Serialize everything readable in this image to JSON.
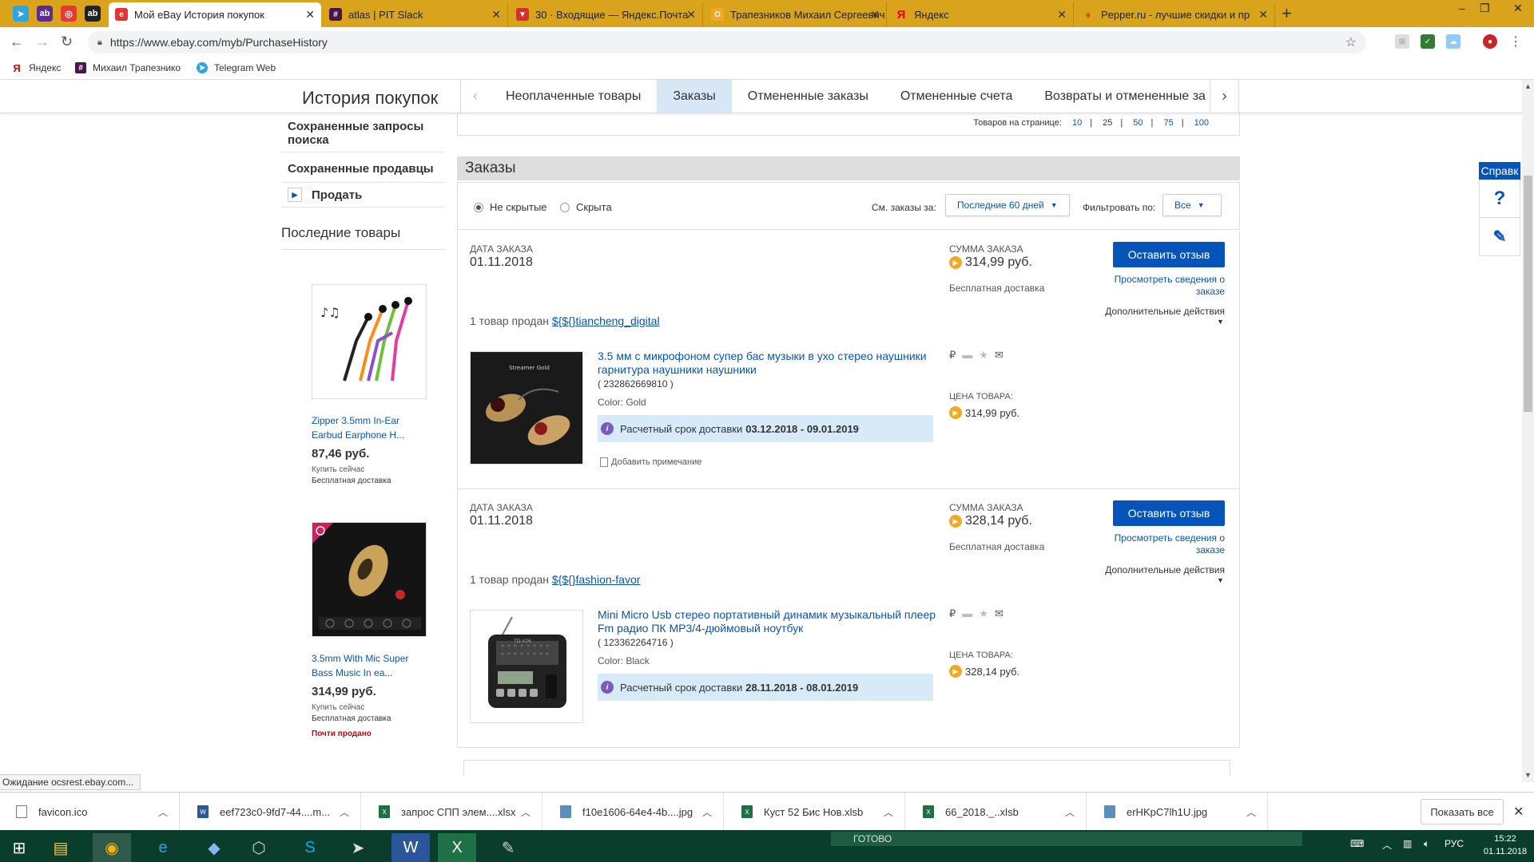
{
  "browser": {
    "tabs": [
      {
        "label": "Мой eBay История покупок",
        "active": true
      },
      {
        "label": "atlas | PIT Slack",
        "active": false
      },
      {
        "label": "30 · Входящие — Яндекс.Почта",
        "active": false
      },
      {
        "label": "Трапезников Михаил Сергеевич",
        "active": false
      },
      {
        "label": "Яндекс",
        "active": false
      },
      {
        "label": "Pepper.ru - лучшие скидки и пр",
        "active": false
      }
    ],
    "new_tab": "+",
    "url": "https://www.ebay.com/myb/PurchaseHistory",
    "bookmarks": [
      "Яндекс",
      "Михаил Трапезнико",
      "Telegram Web"
    ],
    "status_text": "Ожидание ocsrest.ebay.com..."
  },
  "header": {
    "title": "История покупок",
    "tabs": [
      "Неоплаченные товары",
      "Заказы",
      "Отмененные заказы",
      "Отмененные счета",
      "Возвраты и отмененные за"
    ],
    "selected_tab": "Заказы"
  },
  "leftnav": {
    "items": [
      "Сохраненные запросы поиска",
      "Сохраненные продавцы",
      "Продать"
    ],
    "recent_title": "Последние товары",
    "recent": [
      {
        "name": "Zipper 3.5mm In-Ear Earbud Earphone H...",
        "price": "87,46 руб.",
        "buy": "Купить сейчас",
        "shipping": "Бесплатная доставка",
        "badge": ""
      },
      {
        "name": "3.5mm With Mic Super Bass Music In ea...",
        "price": "314,99 руб.",
        "buy": "Купить сейчас",
        "shipping": "Бесплатная доставка",
        "badge": "Почти продано"
      }
    ]
  },
  "main": {
    "per_page_label": "Товаров на странице:",
    "per_page_options": [
      "10",
      "25",
      "50",
      "75",
      "100"
    ],
    "orders_title": "Заказы",
    "filter": {
      "radio_visible": "Не скрытые",
      "radio_hidden": "Скрыта",
      "period_label": "См. заказы за:",
      "period_value": "Последние 60 дней",
      "filter_label": "Фильтровать по:",
      "filter_value": "Все"
    },
    "labels": {
      "order_date": "ДАТА ЗАКАЗА",
      "order_total": "СУММА ЗАКАЗА",
      "free_shipping": "Бесплатная доставка",
      "review": "Оставить отзыв",
      "details": "Просмотреть сведения о заказе",
      "more_actions": "Дополнительные действия",
      "sold_by": "1 товар продан",
      "item_price": "ЦЕНА ТОВАРА:",
      "eta": "Расчетный срок доставки",
      "add_note": "Добавить примечание"
    },
    "orders": [
      {
        "date": "01.11.2018",
        "total": "314,99 руб.",
        "seller": "${${}tiancheng_digital",
        "title": "3.5 мм с микрофоном супер бас музыки в ухо стерео наушники гарнитура наушники наушники",
        "item_id": "( 232862669810 )",
        "color": "Color: Gold",
        "eta": "03.12.2018 - 09.01.2019",
        "price": "314,99 руб.",
        "image_text": "Streamer Gold"
      },
      {
        "date": "01.11.2018",
        "total": "328,14 руб.",
        "seller": "${${}fashion-favor",
        "title": "Mini Micro Usb стерео портативный динамик музыкальный плеер Fm радио ПК MP3/4-дюймовый ноутбук",
        "item_id": "( 123362264716 )",
        "color": "Color: Black",
        "eta": "28.11.2018 - 08.01.2019",
        "price": "328,14 руб.",
        "image_text": "TD-V26"
      }
    ]
  },
  "help": {
    "label": "Справк"
  },
  "downloads": {
    "files": [
      "favicon.ico",
      "eef723c0-9fd7-44....m...",
      "запрос СПП элем....xlsx",
      "f10e1606-64e4-4b....jpg",
      "Куст 52 Бис Нов.xlsb",
      "66_2018._..xlsb",
      "erHKpC7lh1U.jpg"
    ],
    "show_all": "Показать все"
  },
  "taskbar": {
    "status": "ГОТОВО",
    "lang": "РУС",
    "time": "15:22",
    "date": "01.11.2018"
  },
  "colors": {
    "ebay_blue": "#0654ba",
    "tab_bg": "#d9a41b",
    "taskbar": "#0b3d2c",
    "eta_bg": "#d7eaf8"
  }
}
